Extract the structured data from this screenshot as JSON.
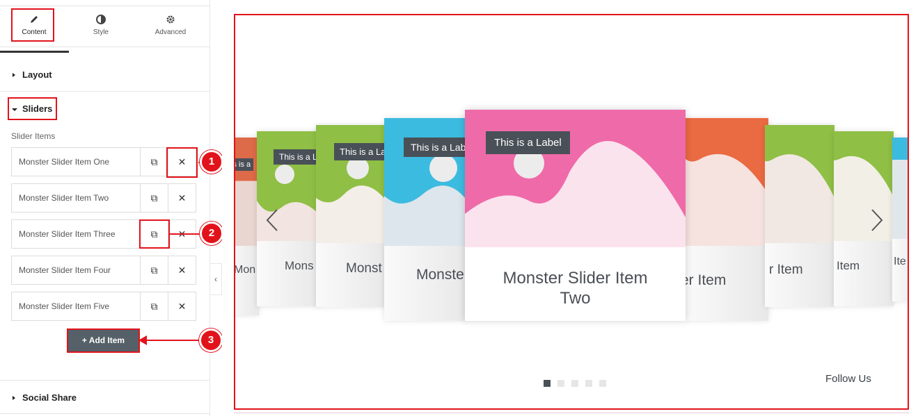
{
  "panel": {
    "tabs": [
      {
        "label": "Content",
        "icon": "pencil-icon"
      },
      {
        "label": "Style",
        "icon": "contrast-icon"
      },
      {
        "label": "Advanced",
        "icon": "gear-icon"
      }
    ],
    "sections": {
      "layout": "Layout",
      "sliders": "Sliders",
      "social_share": "Social Share"
    },
    "slider_items_label": "Slider Items",
    "items": [
      "Monster Slider Item One",
      "Monster Slider Item Two",
      "Monster Slider Item Three",
      "Monster Slider Item Four",
      "Monster Slider Item Five"
    ],
    "add_item_label": "+  Add Item",
    "collapse_glyph": "‹"
  },
  "annotations": [
    "1",
    "2",
    "3"
  ],
  "preview": {
    "active_label": "This is a Label",
    "active_title_line1": "Monster Slider Item",
    "active_title_line2": "Two",
    "side_labels": [
      "This is a Lab",
      "This is a La",
      "This is a L",
      "is is a"
    ],
    "side_titles": [
      "Monste",
      "Monst",
      "Mons",
      "Mon",
      "er Item",
      "r Item",
      "r Item",
      "Item",
      "Ite"
    ],
    "dots_total": 5,
    "dots_active_index": 0,
    "follow_us": "Follow Us"
  },
  "colors": {
    "accent_red": "#e2121b",
    "pink": "#ef6aa8",
    "blue": "#3cbbe0",
    "green": "#8fbf45",
    "orange": "#ea6a42",
    "chip": "#4a5058"
  }
}
